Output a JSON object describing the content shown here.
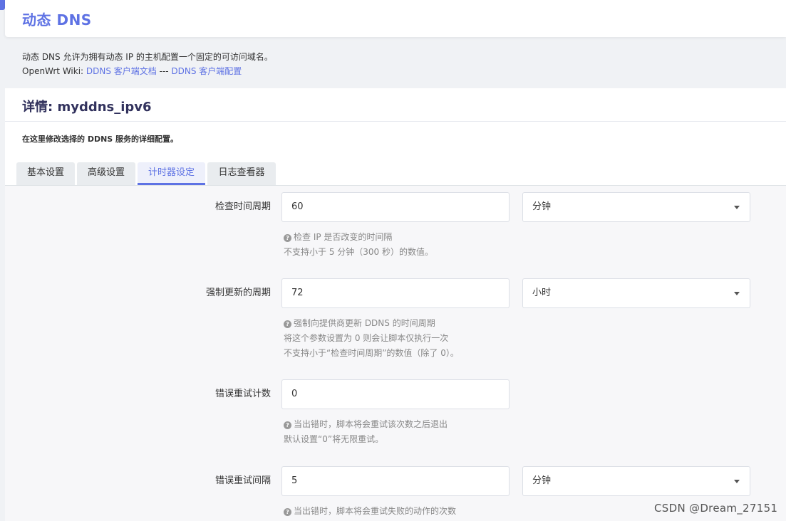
{
  "header": {
    "title": "动态 DNS"
  },
  "description": {
    "line1": "动态 DNS 允许为拥有动态 IP 的主机配置一个固定的可访问域名。",
    "wiki_prefix": "OpenWrt Wiki: ",
    "link_docs": "DDNS 客户端文档",
    "separator": " --- ",
    "link_config": "DDNS 客户端配置"
  },
  "details": {
    "title": "详情: myddns_ipv6",
    "description": "在这里修改选择的 DDNS 服务的详细配置。"
  },
  "tabs": [
    {
      "label": "基本设置",
      "active": false
    },
    {
      "label": "高级设置",
      "active": false
    },
    {
      "label": "计时器设定",
      "active": true
    },
    {
      "label": "日志查看器",
      "active": false
    }
  ],
  "fields": [
    {
      "label": "检查时间周期",
      "value": "60",
      "unit": "分钟",
      "help": [
        "检查 IP 是否改变的时间隔",
        "不支持小于 5 分钟（300 秒）的数值。"
      ]
    },
    {
      "label": "强制更新的周期",
      "value": "72",
      "unit": "小时",
      "help": [
        "强制向提供商更新 DDNS 的时间周期",
        "将这个参数设置为 0 则会让脚本仅执行一次",
        "不支持小于“检查时间周期”的数值（除了 0）。"
      ]
    },
    {
      "label": "错误重试计数",
      "value": "0",
      "help": [
        "当出错时，脚本将会重试该次数之后退出",
        "默认设置“0”将无限重试。"
      ]
    },
    {
      "label": "错误重试间隔",
      "value": "5",
      "unit": "分钟",
      "help": [
        "当出错时，脚本将会重试失败的动作的次数"
      ]
    }
  ],
  "watermark": "CSDN @Dream_27151",
  "colors": {
    "accent": "#5e72e4",
    "background": "#f0f2f5"
  }
}
